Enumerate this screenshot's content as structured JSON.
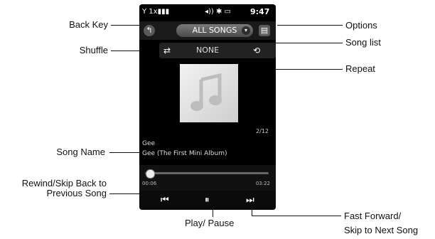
{
  "status_bar": {
    "signal": "Y 1x▮▮▮",
    "icons": "◂)) ✱ ▭",
    "time": "9:47"
  },
  "top_bar": {
    "back_icon": "↰",
    "song_list_label": "ALL SONGS",
    "song_list_caret": "▾",
    "options_icon": "▤"
  },
  "mode_bar": {
    "shuffle_icon": "⇄",
    "repeat_mode_label": "NONE",
    "repeat_icon": "⟲"
  },
  "track": {
    "position": "2/12",
    "artist": "Gee",
    "album": "Gee (The First Mini Album)",
    "elapsed": "00:06",
    "duration": "03:22",
    "progress": 0.03
  },
  "transport": {
    "prev_icon": "⏮",
    "play_pause_icon": "⏸",
    "next_icon": "⏭"
  },
  "callouts": {
    "back_key": "Back Key",
    "shuffle": "Shuffle",
    "song_name": "Song Name",
    "rewind_line1": "Rewind/Skip Back to",
    "rewind_line2": "Previous Song",
    "play_pause": "Play/ Pause",
    "options": "Options",
    "song_list": "Song list",
    "repeat": "Repeat",
    "ff_line1": "Fast Forward/",
    "ff_line2": "Skip to Next Song"
  }
}
